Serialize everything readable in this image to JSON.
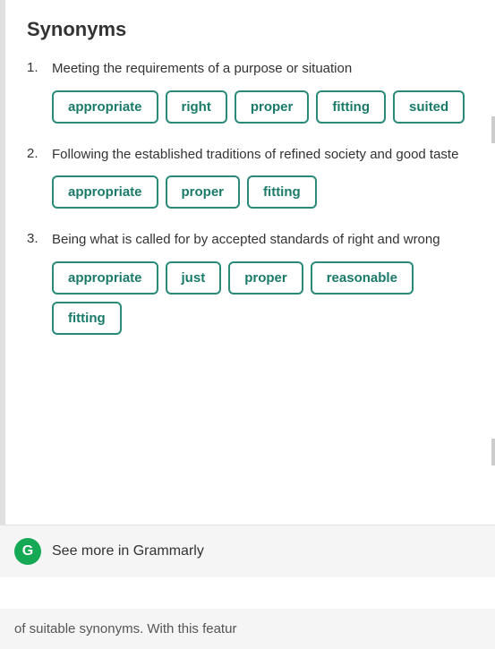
{
  "title": "Synonyms",
  "definitions": [
    {
      "number": "1.",
      "text": "Meeting the requirements of a purpose or situation",
      "synonyms": [
        "appropriate",
        "right",
        "proper",
        "fitting",
        "suited"
      ]
    },
    {
      "number": "2.",
      "text": "Following the established traditions of refined society and good taste",
      "synonyms": [
        "appropriate",
        "proper",
        "fitting"
      ]
    },
    {
      "number": "3.",
      "text": "Being what is called for by accepted standards of right and wrong",
      "synonyms": [
        "appropriate",
        "just",
        "proper",
        "reasonable",
        "fitting"
      ]
    }
  ],
  "grammarly": {
    "see_more_label": "See more in Grammarly"
  },
  "bottom_text": "of suitable synonyms. With this featur"
}
